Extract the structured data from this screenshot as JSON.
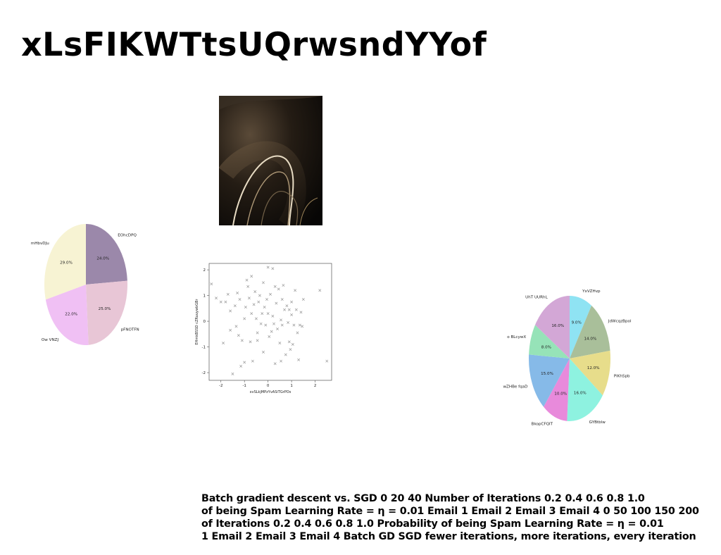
{
  "page": {
    "title": "xLsFIKWTtsUQrwsndYYof",
    "photo_description": "abstract-dark-swirl-photo",
    "caption_lines": [
      "Batch gradient descent vs. SGD 0 20 40 Number of Iterations 0.2 0.4 0.6 0.8 1.0",
      "of being Spam Learning Rate = η = 0.01 Email 1 Email 2 Email 3 Email 4 0 50 100 150 200",
      "of Iterations 0.2 0.4 0.6 0.8 1.0 Probability of being Spam Learning Rate = η = 0.01",
      "1 Email 2 Email 3 Email 4 Batch GD SGD fewer iterations, more iterations, every iteration"
    ]
  },
  "chart_data": [
    {
      "type": "pie",
      "start_angle_deg": 90,
      "slices": [
        {
          "label": "EOhcDPQ",
          "value": 24.0,
          "pct_label": "24.0%",
          "color": "#9b88aa"
        },
        {
          "label": "pFNOTFN",
          "value": 25.0,
          "pct_label": "25.0%",
          "color": "#e8c6d6"
        },
        {
          "label": "Ow VNZJ",
          "value": 22.0,
          "pct_label": "22.0%",
          "color": "#f0c0f4"
        },
        {
          "label": "mHbvDJu",
          "value": 29.0,
          "pct_label": "29.0%",
          "color": "#f7f3d3"
        }
      ]
    },
    {
      "type": "scatter",
      "xlabel": "xvSLkjMPzYvASiTGrPOs",
      "ylabel": "EHmkBSSD cZRuuywbGBr",
      "xlim": [
        -2.5,
        2.7
      ],
      "ylim": [
        -2.3,
        2.25
      ],
      "xticks": [
        -2,
        -1,
        0,
        1,
        2
      ],
      "yticks": [
        -2,
        -1,
        0,
        1,
        2
      ],
      "marker": "x",
      "color": "#999999",
      "points": [
        [
          -2.4,
          1.45
        ],
        [
          -2.2,
          0.9
        ],
        [
          -2.0,
          0.75
        ],
        [
          -1.9,
          -0.85
        ],
        [
          -1.7,
          1.05
        ],
        [
          -1.6,
          0.4
        ],
        [
          -1.6,
          -0.35
        ],
        [
          -1.5,
          -2.05
        ],
        [
          -1.4,
          0.6
        ],
        [
          -1.35,
          -0.2
        ],
        [
          -1.3,
          1.1
        ],
        [
          -1.2,
          0.85
        ],
        [
          -1.15,
          -1.75
        ],
        [
          -1.1,
          -0.75
        ],
        [
          -1.0,
          0.1
        ],
        [
          -1.0,
          -1.6
        ],
        [
          -0.95,
          0.55
        ],
        [
          -0.9,
          1.6
        ],
        [
          -0.85,
          1.35
        ],
        [
          -0.8,
          0.9
        ],
        [
          -0.75,
          -0.8
        ],
        [
          -0.7,
          0.3
        ],
        [
          -0.65,
          -1.55
        ],
        [
          -0.6,
          0.65
        ],
        [
          -0.55,
          1.15
        ],
        [
          -0.5,
          0.1
        ],
        [
          -0.45,
          -0.45
        ],
        [
          -0.4,
          0.75
        ],
        [
          -0.35,
          1.0
        ],
        [
          -0.3,
          -0.1
        ],
        [
          -0.25,
          0.3
        ],
        [
          -0.2,
          -1.2
        ],
        [
          -0.15,
          0.55
        ],
        [
          -0.1,
          -0.15
        ],
        [
          -0.05,
          0.85
        ],
        [
          0.0,
          2.1
        ],
        [
          0.0,
          0.3
        ],
        [
          0.05,
          -0.6
        ],
        [
          0.1,
          1.05
        ],
        [
          0.15,
          -0.4
        ],
        [
          0.2,
          2.05
        ],
        [
          0.2,
          0.2
        ],
        [
          0.25,
          -0.1
        ],
        [
          0.3,
          -1.65
        ],
        [
          0.35,
          0.7
        ],
        [
          0.4,
          -0.3
        ],
        [
          0.45,
          1.25
        ],
        [
          0.5,
          -0.85
        ],
        [
          0.55,
          -1.55
        ],
        [
          0.6,
          0.85
        ],
        [
          0.6,
          -0.15
        ],
        [
          0.65,
          1.4
        ],
        [
          0.7,
          0.45
        ],
        [
          0.75,
          -1.3
        ],
        [
          0.8,
          0.6
        ],
        [
          0.85,
          -0.05
        ],
        [
          0.9,
          -0.8
        ],
        [
          0.95,
          -1.1
        ],
        [
          1.0,
          0.25
        ],
        [
          1.0,
          0.75
        ],
        [
          1.05,
          -0.9
        ],
        [
          1.1,
          -0.15
        ],
        [
          1.15,
          1.2
        ],
        [
          1.2,
          0.45
        ],
        [
          1.3,
          -1.5
        ],
        [
          1.35,
          -0.15
        ],
        [
          1.4,
          0.35
        ],
        [
          1.5,
          0.85
        ],
        [
          2.2,
          1.2
        ],
        [
          2.5,
          -1.55
        ],
        [
          -0.7,
          1.75
        ],
        [
          0.3,
          1.35
        ],
        [
          -1.8,
          0.75
        ],
        [
          0.9,
          0.45
        ],
        [
          -0.45,
          -0.75
        ],
        [
          1.25,
          -0.45
        ],
        [
          -0.2,
          1.5
        ],
        [
          0.55,
          0.05
        ],
        [
          -1.25,
          -0.55
        ],
        [
          1.45,
          -0.2
        ]
      ]
    },
    {
      "type": "pie",
      "start_angle_deg": 90,
      "slices": [
        {
          "label": "YxVZHvp",
          "value": 9.0,
          "pct_label": "9.0%",
          "color": "#8fe3f3"
        },
        {
          "label": "JdWcqzBpol",
          "value": 14.0,
          "pct_label": "14.0%",
          "color": "#a9bf9a"
        },
        {
          "label": "PiKhSpb",
          "value": 12.0,
          "pct_label": "12.0%",
          "color": "#e7dd8b"
        },
        {
          "label": "GYBtblw",
          "value": 16.0,
          "pct_label": "16.0%",
          "color": "#8ef2e0"
        },
        {
          "label": "BkopCFQIT",
          "value": 10.0,
          "pct_label": "10.0%",
          "color": "#e88adb"
        },
        {
          "label": "wZHBe fqaD",
          "value": 15.0,
          "pct_label": "15.0%",
          "color": "#86bae8"
        },
        {
          "label": "o BLcywX",
          "value": 8.0,
          "pct_label": "8.0%",
          "color": "#96e3b8"
        },
        {
          "label": "UhT UURhL",
          "value": 16.0,
          "pct_label": "16.0%",
          "color": "#d3a7d6"
        }
      ]
    }
  ]
}
